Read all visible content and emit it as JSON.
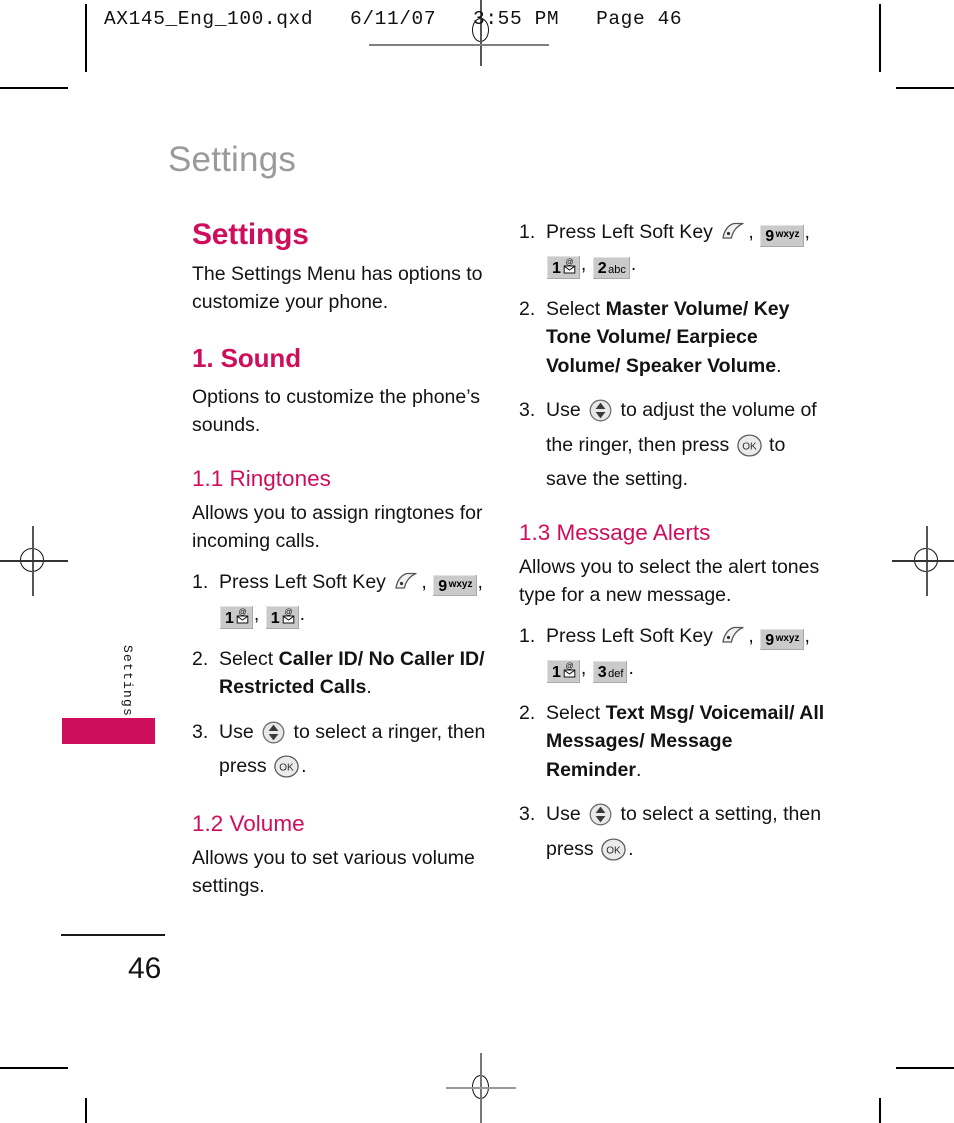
{
  "film_header": {
    "text": "AX145_Eng_100.qxd   6/11/07   3:55 PM   Page 46"
  },
  "running_head": "Settings",
  "side_tab": {
    "label": "Settings",
    "color": "#ce0e5c"
  },
  "folio": "46",
  "accent_color": "#ce0e5c",
  "left_column": {
    "section_title": "Settings",
    "intro": "The Settings Menu has options to customize your phone.",
    "sound": {
      "heading": "1. Sound",
      "intro": "Options to customize the phone’s sounds."
    },
    "ringtones": {
      "heading": "1.1 Ringtones",
      "intro": "Allows you to assign ringtones for incoming calls.",
      "steps": [
        {
          "num": "1.",
          "lead": "Press Left Soft Key",
          "keys": [
            "soft-key",
            "9 wxyz",
            "1 @✉",
            "1 @✉"
          ],
          "tail": "."
        },
        {
          "num": "2.",
          "lead": "Select ",
          "bold": "Caller ID/ No Caller ID/ Restricted Calls",
          "tail": "."
        },
        {
          "num": "3.",
          "lead": "Use ",
          "mid": " to select a ringer, then press ",
          "tail": "."
        }
      ]
    },
    "volume": {
      "heading": "1.2 Volume",
      "intro": "Allows you to set various volume settings."
    }
  },
  "right_column": {
    "volume_steps": [
      {
        "num": "1.",
        "lead": "Press Left Soft Key",
        "keys": [
          "soft-key",
          "9 wxyz",
          "1 @✉",
          "2 abc"
        ],
        "tail": "."
      },
      {
        "num": "2.",
        "lead": "Select ",
        "bold": "Master Volume/ Key Tone Volume/ Earpiece Volume/ Speaker Volume",
        "tail": "."
      },
      {
        "num": "3.",
        "lead": "Use ",
        "mid": " to adjust the volume of the ringer, then press ",
        "tail": " to save the setting."
      }
    ],
    "message_alerts": {
      "heading": "1.3 Message Alerts",
      "intro": "Allows you to select the alert tones type for a new message.",
      "steps": [
        {
          "num": "1.",
          "lead": "Press Left Soft Key",
          "keys": [
            "soft-key",
            "9 wxyz",
            "1 @✉",
            "3 def"
          ],
          "tail": "."
        },
        {
          "num": "2.",
          "lead": "Select ",
          "bold": "Text Msg/ Voicemail/ All Messages/ Message Reminder",
          "tail": "."
        },
        {
          "num": "3.",
          "lead": "Use ",
          "mid": " to select a setting, then press ",
          "tail": "."
        }
      ]
    }
  },
  "keys": {
    "k9": {
      "digit": "9",
      "letters": "wxyz"
    },
    "k1": {
      "digit": "1",
      "letters": "@✉"
    },
    "k2": {
      "digit": "2",
      "letters": "abc"
    },
    "k3": {
      "digit": "3",
      "letters": "def"
    },
    "ok": "OK"
  }
}
